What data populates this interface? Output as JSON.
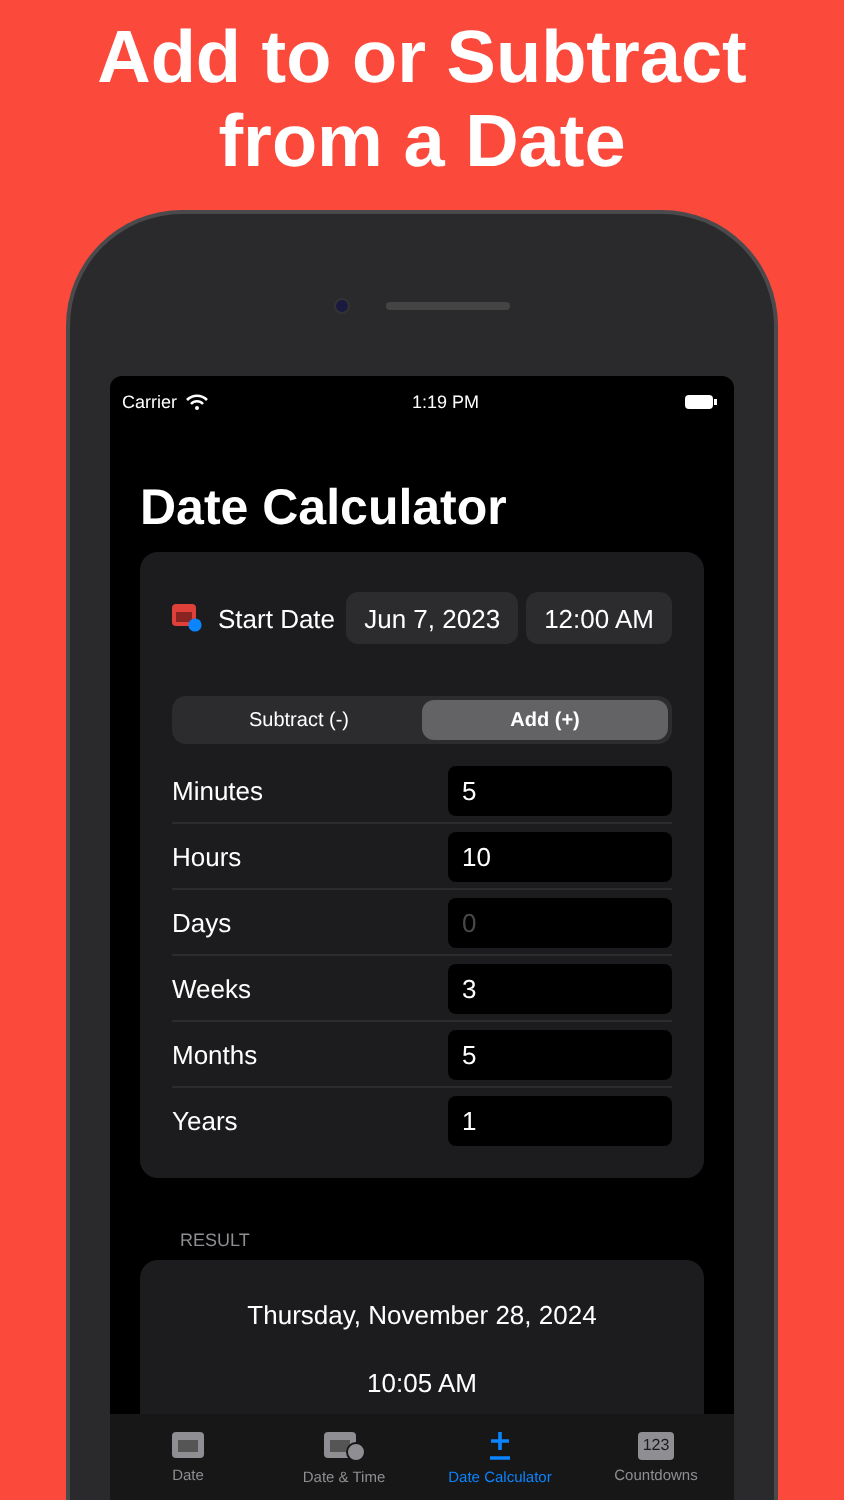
{
  "headline": "Add to or Subtract from a Date",
  "status_bar": {
    "carrier": "Carrier",
    "time": "1:19 PM"
  },
  "title": "Date Calculator",
  "start": {
    "label": "Start Date",
    "date": "Jun 7, 2023",
    "time": "12:00 AM"
  },
  "segments": [
    {
      "label": "Subtract (-)",
      "selected": false
    },
    {
      "label": "Add (+)",
      "selected": true
    }
  ],
  "fields": [
    {
      "label": "Minutes",
      "value": "5"
    },
    {
      "label": "Hours",
      "value": "10"
    },
    {
      "label": "Days",
      "placeholder": "0"
    },
    {
      "label": "Weeks",
      "value": "3"
    },
    {
      "label": "Months",
      "value": "5"
    },
    {
      "label": "Years",
      "value": "1"
    }
  ],
  "result": {
    "heading": "RESULT",
    "date": "Thursday, November 28, 2024",
    "time": "10:05 AM"
  },
  "tabs": [
    {
      "label": "Date",
      "kind": "calendar",
      "selected": false
    },
    {
      "label": "Date & Time",
      "kind": "calendar-clock",
      "selected": false
    },
    {
      "label": "Date Calculator",
      "kind": "plusminus",
      "selected": true
    },
    {
      "label": "Countdowns",
      "kind": "number",
      "icon_text": "123",
      "selected": false
    }
  ]
}
